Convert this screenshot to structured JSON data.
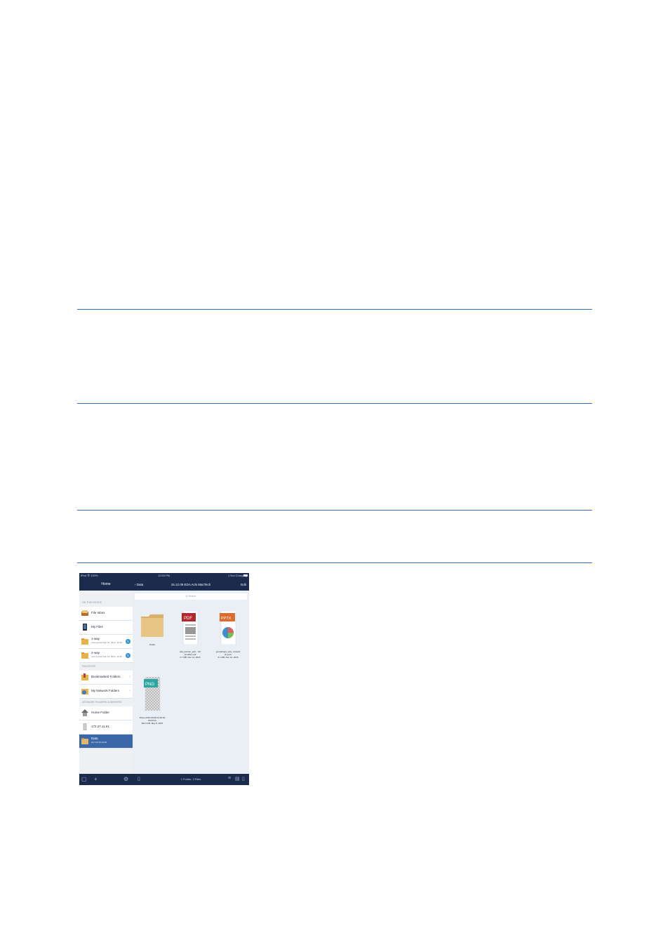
{
  "status_bar": {
    "left": "iPad 令 100%",
    "time": "12:53 PM",
    "right": "1 Not Charging"
  },
  "sidebar": {
    "title": "Home",
    "section_device": "ON THIS DEVICE",
    "section_favorites": "FAVORITES",
    "section_network": "NETWORK FOLDERS & SERVERS",
    "items": [
      {
        "label": "File Inbox"
      },
      {
        "label": "My Files"
      },
      {
        "label": "1-way",
        "sub": "Last synced Feb 16, 2014, 12:30..."
      },
      {
        "label": "2-way",
        "sub": "Last synced Feb 16, 2014, 12:30..."
      },
      {
        "label": "Bookmarked Folders"
      },
      {
        "label": "My Network Folders"
      },
      {
        "label": "Home Folder"
      },
      {
        "label": "172.27.11.91"
      },
      {
        "label": "Data",
        "sub": "On 172.27.11.91"
      }
    ]
  },
  "content": {
    "back_label": "Data",
    "title": "15.12.09 EDA Acls MacTech",
    "edit_label": "Edit",
    "search_placeholder": "Q Search",
    "files": [
      {
        "name": "Drafts"
      },
      {
        "name": "eda_partner_acls - SU (smaller).pdf",
        "meta": "2.7 MB, Dec 14, 2015",
        "badge": "PDF"
      },
      {
        "name": "groupblogic_acls_review4 (1).pptx",
        "meta": "2.1 MB, Dec 14, 2015",
        "badge": "PPTX"
      },
      {
        "name": "Photo 2015-05-08 01:20:30 PM.PNG",
        "meta": "991.0 KB, May 8, 2015",
        "badge": "PNG"
      }
    ],
    "footer_count": "1 Folder, 3 Files"
  },
  "colors": {
    "rule": "#2f6fb5",
    "nav_bar": "#1b2b4e",
    "selection": "#3a67a8",
    "pdf": "#b5262b",
    "pptx": "#e06a2c",
    "png": "#2ba6a0"
  }
}
